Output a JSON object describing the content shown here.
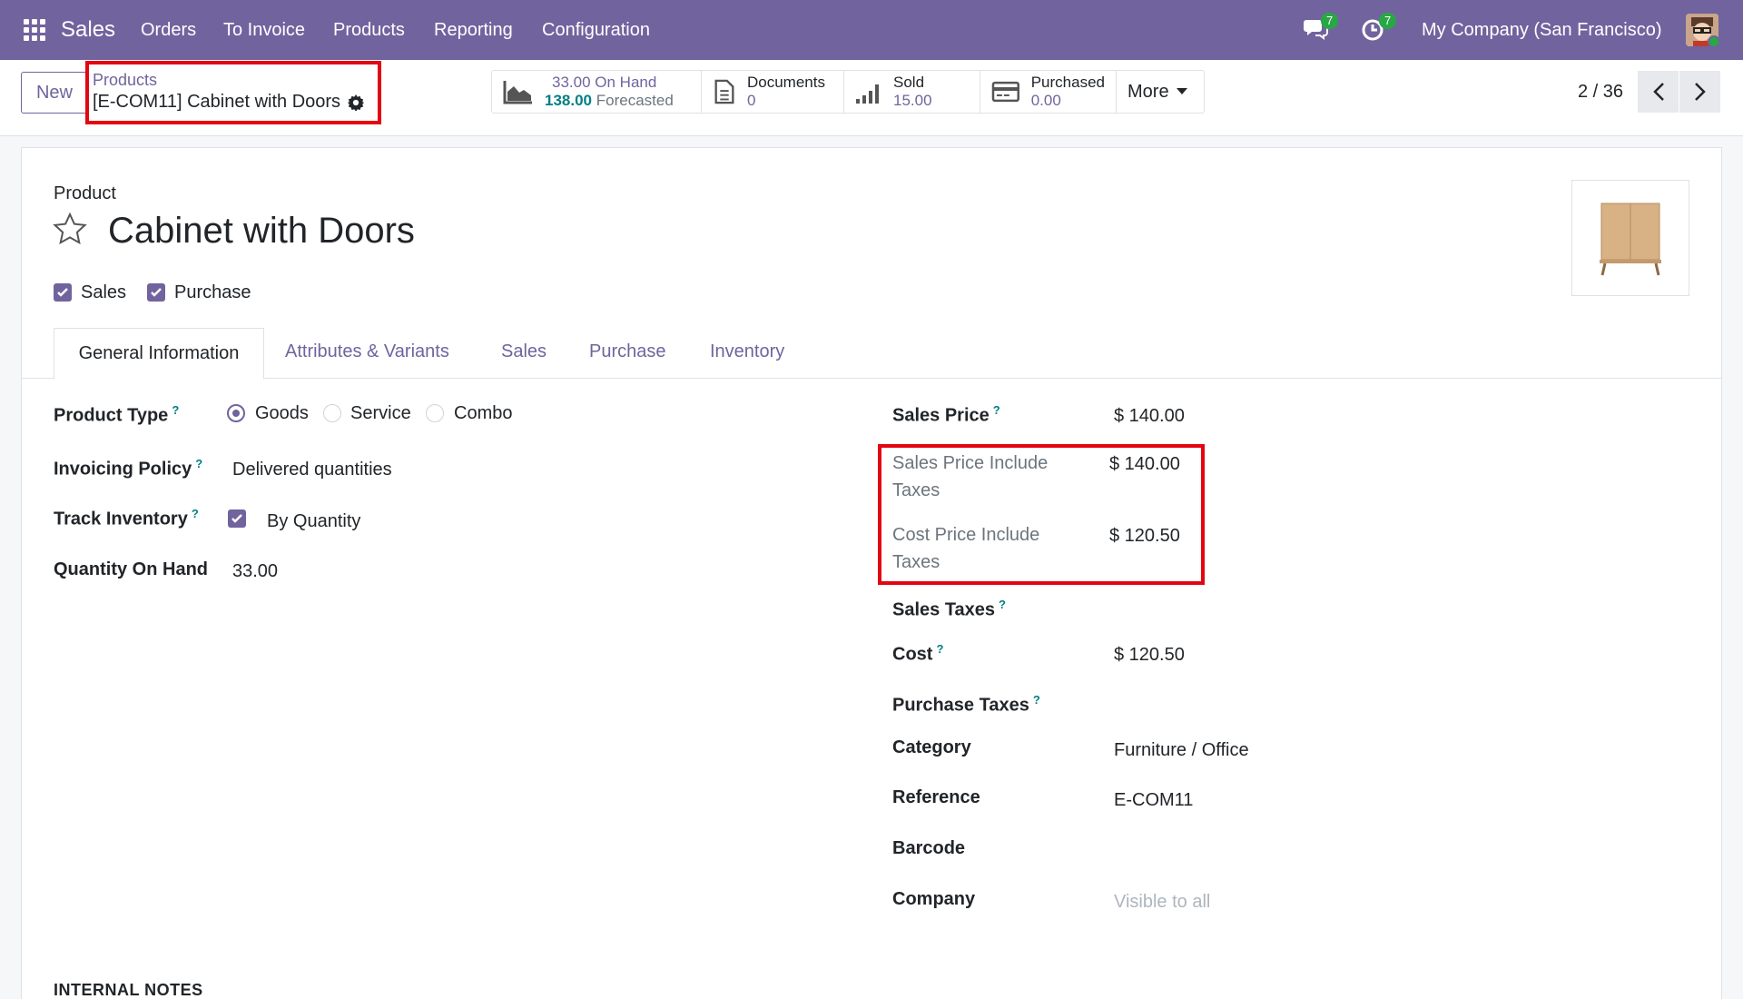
{
  "navbar": {
    "app_name": "Sales",
    "menu": [
      "Orders",
      "To Invoice",
      "Products",
      "Reporting",
      "Configuration"
    ],
    "messages_count": "7",
    "activities_count": "7",
    "company": "My Company (San Francisco)"
  },
  "control_panel": {
    "new_label": "New",
    "breadcrumb_parent": "Products",
    "breadcrumb_current": "[E-COM11] Cabinet with Doors",
    "stats": {
      "on_hand_value": "33.00",
      "on_hand_label": "On Hand",
      "forecast_value": "138.00",
      "forecast_label": "Forecasted",
      "documents_label": "Documents",
      "documents_value": "0",
      "sold_label": "Sold",
      "sold_value": "15.00",
      "purchased_label": "Purchased",
      "purchased_value": "0.00",
      "more_label": "More"
    },
    "pager": "2 / 36"
  },
  "product": {
    "type_label": "Product",
    "name": "Cabinet with Doors",
    "can_be_sold_label": "Sales",
    "can_be_purchased_label": "Purchase"
  },
  "tabs": [
    "General Information",
    "Attributes & Variants",
    "Sales",
    "Purchase",
    "Inventory"
  ],
  "left_fields": {
    "product_type_label": "Product Type",
    "product_type_options": [
      "Goods",
      "Service",
      "Combo"
    ],
    "invoicing_policy_label": "Invoicing Policy",
    "invoicing_policy_value": "Delivered quantities",
    "track_inventory_label": "Track Inventory",
    "track_inventory_value": "By Quantity",
    "qty_on_hand_label": "Quantity On Hand",
    "qty_on_hand_value": "33.00"
  },
  "right_fields": {
    "sales_price_label": "Sales Price",
    "sales_price_value": "$ 140.00",
    "sales_price_incl_label": "Sales Price Include Taxes",
    "sales_price_incl_value": "$ 140.00",
    "cost_price_incl_label": "Cost Price Include Taxes",
    "cost_price_incl_value": "$ 120.50",
    "sales_taxes_label": "Sales Taxes",
    "cost_label": "Cost",
    "cost_value": "$ 120.50",
    "purchase_taxes_label": "Purchase Taxes",
    "category_label": "Category",
    "category_value": "Furniture / Office",
    "reference_label": "Reference",
    "reference_value": "E-COM11",
    "barcode_label": "Barcode",
    "company_label": "Company",
    "company_placeholder": "Visible to all"
  },
  "internal_notes_label": "INTERNAL NOTES",
  "colors": {
    "brand": "#71639e",
    "accent_teal": "#017e84",
    "highlight": "#e20613",
    "badge": "#28a745"
  },
  "icons": [
    "apps-grid-icon",
    "chat-icon",
    "clock-icon",
    "gear-icon",
    "area-chart-icon",
    "document-icon",
    "bar-signal-icon",
    "credit-card-icon",
    "caret-down-icon",
    "chevron-left-icon",
    "chevron-right-icon",
    "star-icon",
    "checkbox-icon"
  ]
}
